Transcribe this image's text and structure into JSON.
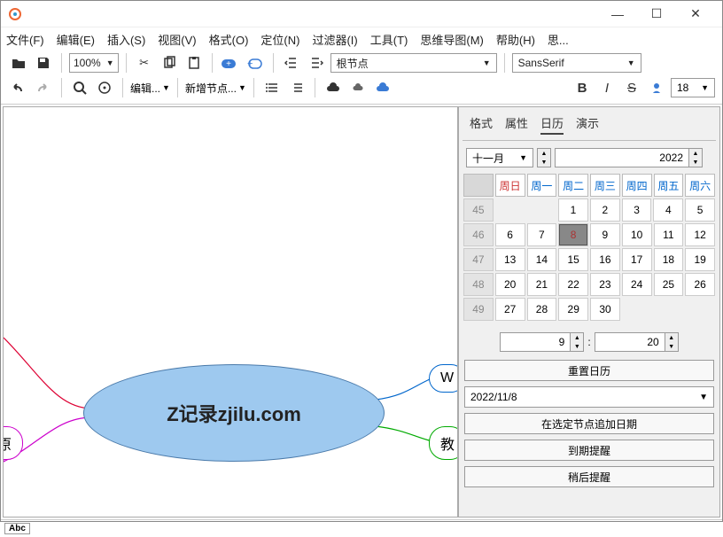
{
  "menu": {
    "file": "文件(F)",
    "edit": "编辑(E)",
    "insert": "插入(S)",
    "view": "视图(V)",
    "format": "格式(O)",
    "navigate": "定位(N)",
    "filter": "过滤器(I)",
    "tools": "工具(T)",
    "mindmap": "思维导图(M)",
    "help": "帮助(H)",
    "more": "思..."
  },
  "toolbar": {
    "zoom": "100%",
    "edit_label": "编辑...",
    "newnode_label": "新增节点...",
    "root_combo": "根节点",
    "font_combo": "SansSerif",
    "font_size": "18"
  },
  "sidepanel": {
    "tabs": {
      "format": "格式",
      "attrs": "属性",
      "calendar": "日历",
      "present": "演示"
    },
    "month": "十一月",
    "year": "2022",
    "weekdays": [
      "周日",
      "周一",
      "周二",
      "周三",
      "周四",
      "周五",
      "周六"
    ],
    "weeks": [
      "45",
      "46",
      "47",
      "48",
      "49"
    ],
    "days": [
      [
        "",
        "",
        "1",
        "2",
        "3",
        "4",
        "5"
      ],
      [
        "6",
        "7",
        "8",
        "9",
        "10",
        "11",
        "12"
      ],
      [
        "13",
        "14",
        "15",
        "16",
        "17",
        "18",
        "19"
      ],
      [
        "20",
        "21",
        "22",
        "23",
        "24",
        "25",
        "26"
      ],
      [
        "27",
        "28",
        "29",
        "30",
        "",
        "",
        ""
      ]
    ],
    "today": "8",
    "hour": "9",
    "minute": "20",
    "time_sep": ":",
    "reset": "重置日历",
    "date": "2022/11/8",
    "append": "在选定节点追加日期",
    "due": "到期提醒",
    "later": "稍后提醒"
  },
  "mindmap": {
    "center": "Z记录zjilu.com",
    "left": "原",
    "right1": "W",
    "right2": "教"
  },
  "status": {
    "abc": "Abc"
  }
}
